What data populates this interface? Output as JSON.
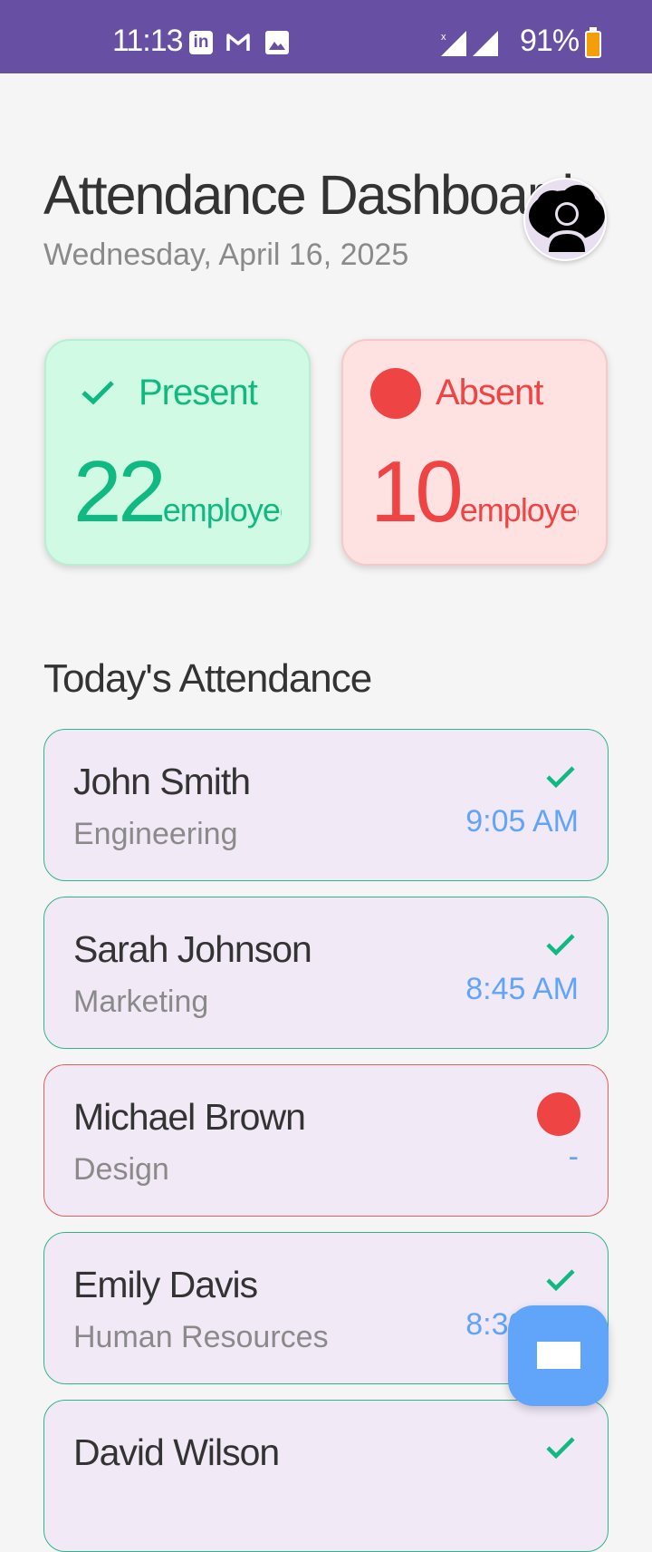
{
  "status_bar": {
    "time": "11:13",
    "battery": "91%",
    "linkedin_glyph": "in",
    "icons": [
      "linkedin-icon",
      "gmail-icon",
      "gallery-icon",
      "signal-icon",
      "battery-icon"
    ]
  },
  "header": {
    "title": "Attendance Dashboard",
    "date": "Wednesday, April 16, 2025"
  },
  "summary": {
    "present": {
      "label": "Present",
      "count": "22",
      "unit": "employees"
    },
    "absent": {
      "label": "Absent",
      "count": "10",
      "unit": "employees"
    }
  },
  "section_title": "Today's Attendance",
  "employees": [
    {
      "name": "John Smith",
      "department": "Engineering",
      "time": "9:05 AM",
      "status": "present"
    },
    {
      "name": "Sarah Johnson",
      "department": "Marketing",
      "time": "8:45 AM",
      "status": "present"
    },
    {
      "name": "Michael Brown",
      "department": "Design",
      "time": "-",
      "status": "absent"
    },
    {
      "name": "Emily Davis",
      "department": "Human Resources",
      "time": "8:30 AM",
      "status": "present"
    },
    {
      "name": "David Wilson",
      "department": "",
      "time": "",
      "status": "present"
    }
  ],
  "colors": {
    "status_bar": "#6750a4",
    "present": "#10b981",
    "absent": "#ef4444",
    "time": "#60a5fa",
    "fab": "#60a5fa"
  }
}
